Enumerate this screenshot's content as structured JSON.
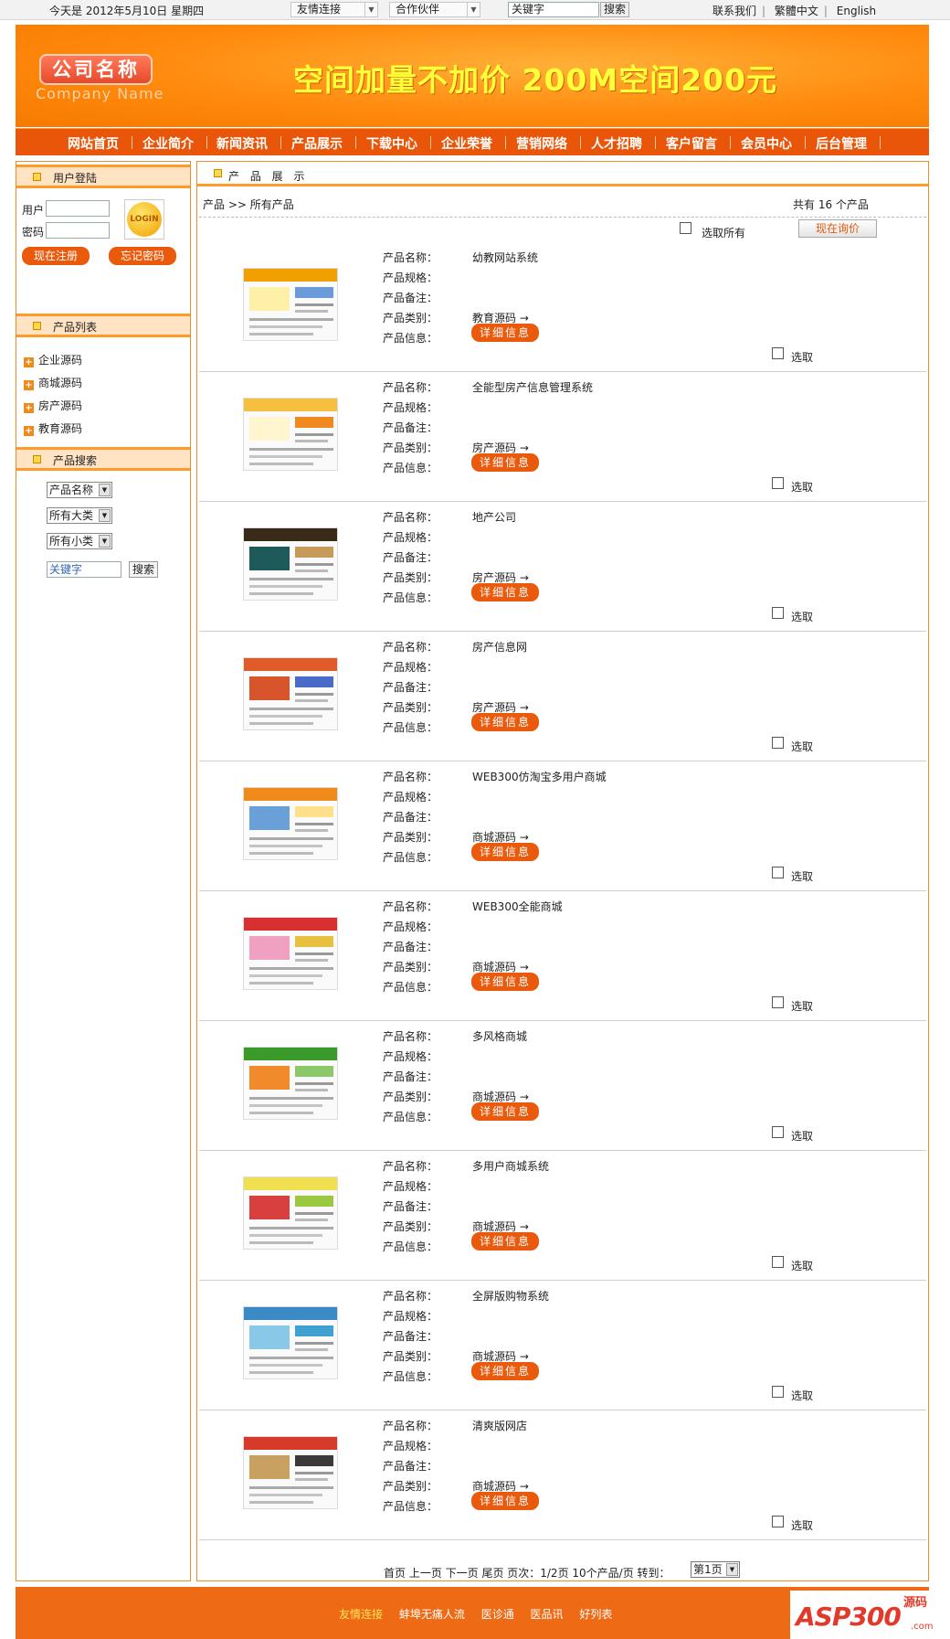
{
  "topbar": {
    "date": "今天是 2012年5月10日 星期四",
    "friend_select": "友情连接",
    "partner_select": "合作伙伴",
    "keyword_value": "关键字",
    "search_label": "搜索",
    "links": [
      "联系我们",
      "繁體中文",
      "English"
    ]
  },
  "banner": {
    "logo_cn": "公司名称",
    "logo_en": "Company Name",
    "slogan": "空间加量不加价  200M空间200元"
  },
  "nav": [
    "网站首页",
    "企业简介",
    "新闻资讯",
    "产品展示",
    "下载中心",
    "企业荣誉",
    "营销网络",
    "人才招聘",
    "客户留言",
    "会员中心",
    "后台管理"
  ],
  "sidebar": {
    "login_title": "用户登陆",
    "user_label": "用户",
    "pass_label": "密码",
    "login_badge": "LOGIN",
    "register_label": "现在注册",
    "forgot_label": "忘记密码",
    "list_title": "产品列表",
    "categories": [
      "企业源码",
      "商城源码",
      "房产源码",
      "教育源码"
    ],
    "search_title": "产品搜索",
    "select_name": "产品名称",
    "select_big": "所有大类",
    "select_small": "所有小类",
    "keyword_value": "关键字",
    "search_label": "搜索"
  },
  "main": {
    "title": "产 品 展 示",
    "breadcrumb": "产品 >> 所有产品",
    "total": "共有  16  个产品",
    "select_all": "选取所有",
    "inquiry_label": "现在询价",
    "field_labels": {
      "name": "产品名称：",
      "spec": "产品规格：",
      "note": "产品备注：",
      "category": "产品类别：",
      "info": "产品信息："
    },
    "detail_label": "详细信息",
    "pick_label": "选取",
    "products": [
      {
        "name": "幼教网站系统",
        "category": "教育源码 →",
        "thumb_colors": [
          "#f2a000",
          "#fff0a8",
          "#6a9ad8"
        ]
      },
      {
        "name": "全能型房产信息管理系统",
        "category": "房产源码 →",
        "thumb_colors": [
          "#f5c040",
          "#fff6d0",
          "#f08a20"
        ]
      },
      {
        "name": "地产公司",
        "category": "房产源码 →",
        "thumb_colors": [
          "#3a2a1a",
          "#1f5a5a",
          "#c89a5a"
        ]
      },
      {
        "name": "房产信息网",
        "category": "房产源码 →",
        "thumb_colors": [
          "#e05a2a",
          "#d8542a",
          "#4a6ac8"
        ]
      },
      {
        "name": "WEB300仿淘宝多用户商城",
        "category": "商城源码 →",
        "thumb_colors": [
          "#f08a1a",
          "#6aa0d8",
          "#ffe08a"
        ]
      },
      {
        "name": "WEB300全能商城",
        "category": "商城源码 →",
        "thumb_colors": [
          "#d83030",
          "#f0a0c0",
          "#e8c040"
        ]
      },
      {
        "name": "多风格商城",
        "category": "商城源码 →",
        "thumb_colors": [
          "#3a9a2a",
          "#f08a2a",
          "#8ac86a"
        ]
      },
      {
        "name": "多用户商城系统",
        "category": "商城源码 →",
        "thumb_colors": [
          "#f0e050",
          "#d84040",
          "#9ac840"
        ]
      },
      {
        "name": "全屏版购物系统",
        "category": "商城源码 →",
        "thumb_colors": [
          "#3a8ac8",
          "#8ac8e8",
          "#40a0d0"
        ]
      },
      {
        "name": "清爽版网店",
        "category": "商城源码 →",
        "thumb_colors": [
          "#d83a2a",
          "#c8a060",
          "#3a3a3a"
        ]
      }
    ],
    "pager": "首页  上一页  下一页  尾页  页次：1/2页   10个产品/页  转到：",
    "page_select": "第1页"
  },
  "footer": {
    "label": "友情连接",
    "links": [
      "蚌埠无痛人流",
      "医诊通",
      "医品讯",
      "好列表"
    ],
    "badge": "ASP300",
    "badge_cn": "源码",
    "badge_com": ".com"
  }
}
